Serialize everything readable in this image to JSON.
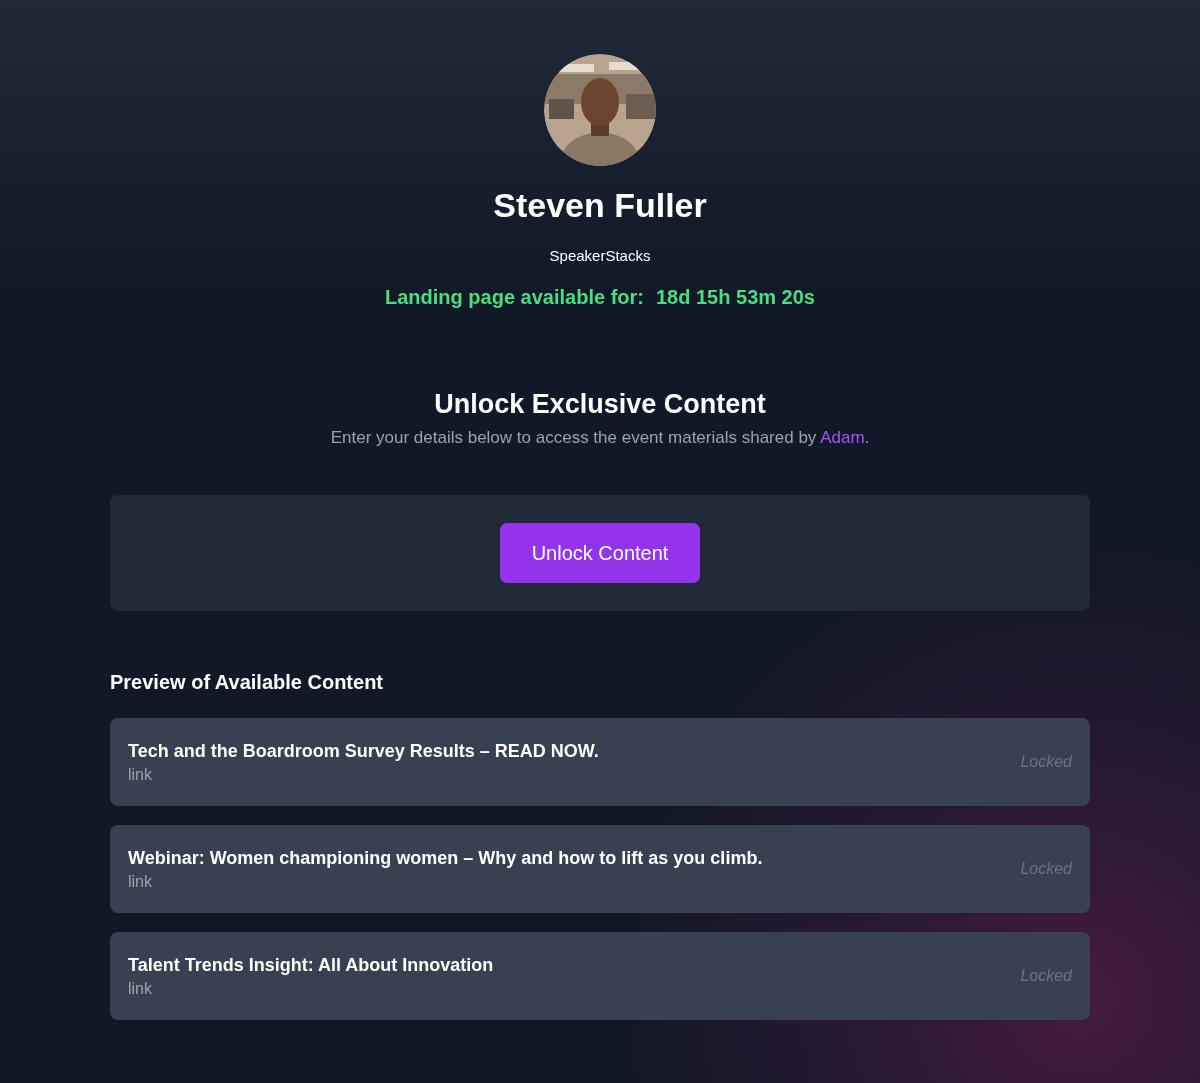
{
  "profile": {
    "name": "Steven Fuller",
    "organization": "SpeakerStacks",
    "countdown": {
      "label": "Landing page available for:",
      "value": "18d 15h 53m 20s"
    }
  },
  "unlock": {
    "title": "Unlock Exclusive Content",
    "description": {
      "before": "Enter your details below to access the event materials shared by ",
      "link": "Adam",
      "after": "."
    },
    "button": "Unlock Content"
  },
  "preview": {
    "title": "Preview of Available Content",
    "items": [
      {
        "title": "Tech and the Boardroom Survey Results – READ NOW.",
        "type": "link",
        "status": "Locked"
      },
      {
        "title": "Webinar: Women championing women – Why and how to lift as you climb.",
        "type": "link",
        "status": "Locked"
      },
      {
        "title": "Talent Trends Insight: All About Innovation",
        "type": "link",
        "status": "Locked"
      }
    ]
  }
}
